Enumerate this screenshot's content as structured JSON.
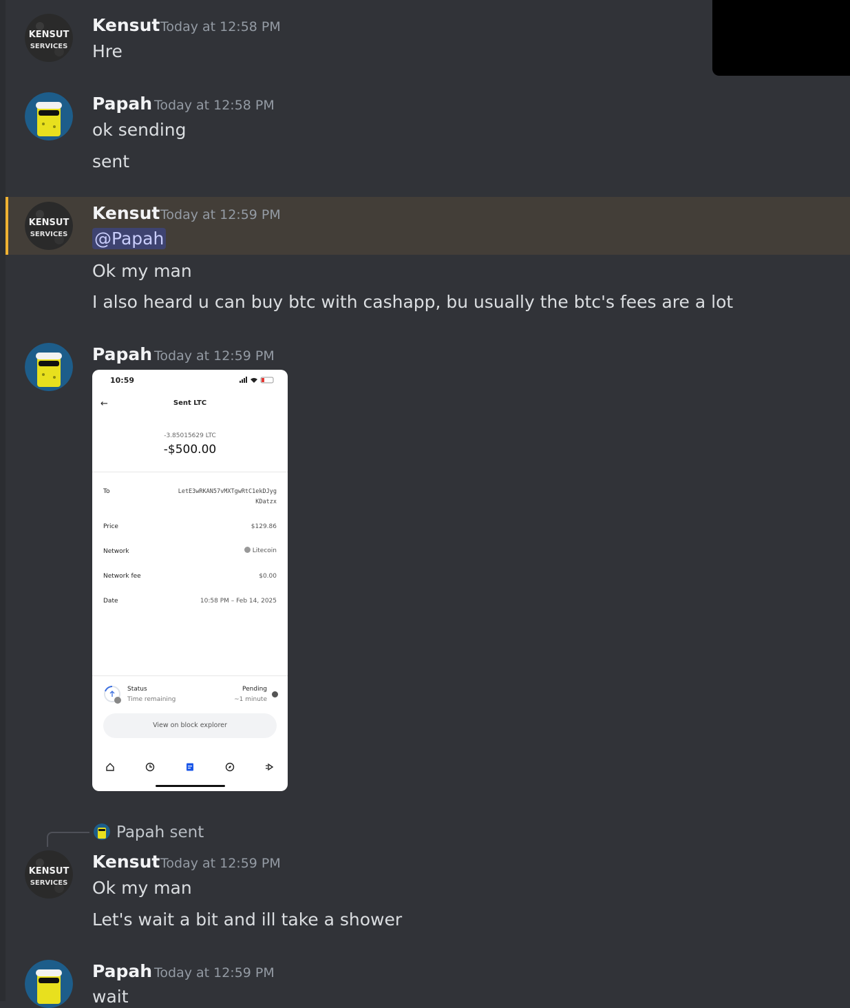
{
  "messages": [
    {
      "author": "Kensut",
      "timestamp": "Today at 12:58 PM",
      "lines": [
        "Hre"
      ]
    },
    {
      "author": "Papah",
      "timestamp": "Today at 12:58 PM",
      "lines": [
        "ok sending",
        "sent"
      ]
    },
    {
      "author": "Kensut",
      "timestamp": "Today at 12:59 PM",
      "mention": "@Papah",
      "lines": [
        "Ok my man",
        "I also heard u can buy btc with cashapp,  bu usually the btc's fees are a lot"
      ]
    },
    {
      "author": "Papah",
      "timestamp": "Today at 12:59 PM",
      "attachment": "phone-screenshot"
    },
    {
      "author": "Kensut",
      "timestamp": "Today at 12:59 PM",
      "reply": {
        "name": "Papah",
        "text": "sent"
      },
      "lines": [
        "Ok my man",
        "Let's wait a bit and ill take a shower"
      ]
    },
    {
      "author": "Papah",
      "timestamp": "Today at 12:59 PM",
      "lines": [
        "wait"
      ]
    }
  ],
  "avatars": {
    "kensut_line1": "KENSUT",
    "kensut_line2": "SERVICES"
  },
  "screenshot": {
    "time": "10:59",
    "title": "Sent LTC",
    "crypto_amount": "-3.85015629 LTC",
    "fiat_amount": "-$500.00",
    "rows": {
      "to_label": "To",
      "to_line1": "LetE3wRKAN57vMXTgwRtC1ekDJyg",
      "to_line2": "KDatzx",
      "price_label": "Price",
      "price_value": "$129.86",
      "network_label": "Network",
      "network_value": "Litecoin",
      "fee_label": "Network fee",
      "fee_value": "$0.00",
      "date_label": "Date",
      "date_value": "10:58 PM – Feb 14, 2025"
    },
    "status_label": "Status",
    "status_sub": "Time remaining",
    "status_value": "Pending",
    "status_time": "~1 minute",
    "explorer_button": "View on block explorer"
  },
  "colors": {
    "background": "#313338",
    "highlight": "#433e38",
    "highlight_bar": "#f0b232",
    "mention_bg": "#3e4370",
    "mention_fg": "#c9cdfb"
  }
}
